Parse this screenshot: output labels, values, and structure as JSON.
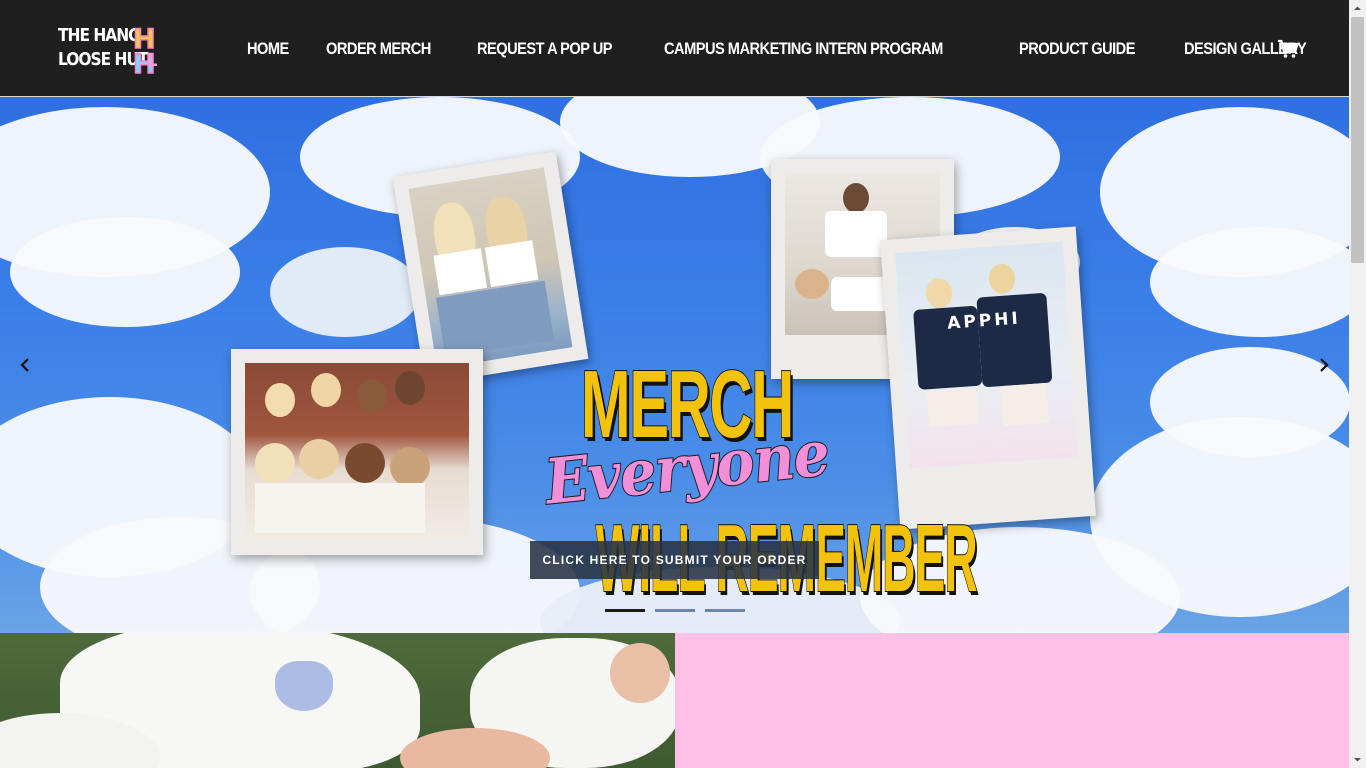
{
  "header": {
    "logo": {
      "line1": "THE HANG",
      "line2": "LOOSE HUT",
      "mark": "HLH"
    },
    "nav": [
      {
        "label": "HOME"
      },
      {
        "label": "ORDER MERCH"
      },
      {
        "label": "REQUEST A POP UP"
      },
      {
        "label": "CAMPUS MARKETING INTERN PROGRAM"
      },
      {
        "label": "PRODUCT GUIDE"
      },
      {
        "label": "DESIGN GALLERY"
      }
    ],
    "cart_icon": "cart-icon"
  },
  "hero": {
    "headline_top": "MERCH",
    "headline_script": "Everyone",
    "headline_bottom": "WILL REMEMBER",
    "cta_label": "CLICK HERE TO SUBMIT YOUR ORDER",
    "prev_icon": "chevron-left-icon",
    "next_icon": "chevron-right-icon",
    "slide_count": 3,
    "active_slide": 1,
    "photo_jersey_text": "APPHI"
  },
  "colors": {
    "header_bg": "#1f1f1f",
    "headline_yellow": "#f3c20d",
    "script_pink": "#f18fd8",
    "sky_blue": "#3b7fe8",
    "pink_panel": "#ffc0e8",
    "cta_bg": "#283244"
  }
}
